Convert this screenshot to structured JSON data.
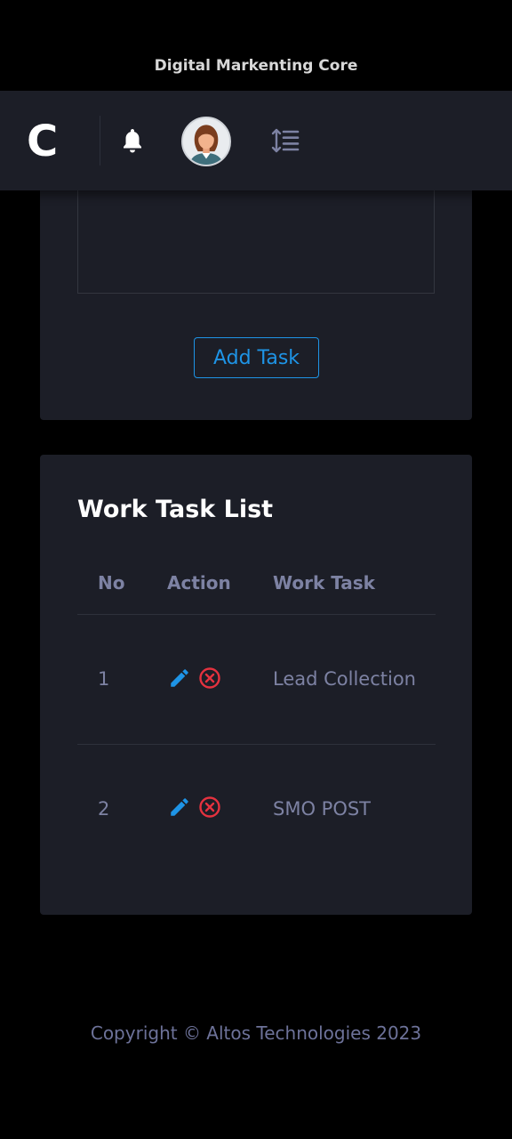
{
  "app": {
    "title": "Digital Markenting Core"
  },
  "topbar": {
    "logo_letter": "C",
    "icons": {
      "bell": "bell-icon",
      "avatar": "user-avatar",
      "menu": "sort-lines-icon"
    }
  },
  "task_form": {
    "add_button_label": "Add Task"
  },
  "task_list": {
    "title": "Work Task List",
    "columns": {
      "no": "No",
      "action": "Action",
      "task": "Work Task"
    },
    "rows": [
      {
        "no": "1",
        "task": "Lead Collection"
      },
      {
        "no": "2",
        "task": "SMO POST"
      }
    ],
    "colors": {
      "edit": "#1e94e6",
      "delete": "#e5323f"
    }
  },
  "footer": {
    "copyright": "Copyright © Altos Technologies 2023"
  }
}
